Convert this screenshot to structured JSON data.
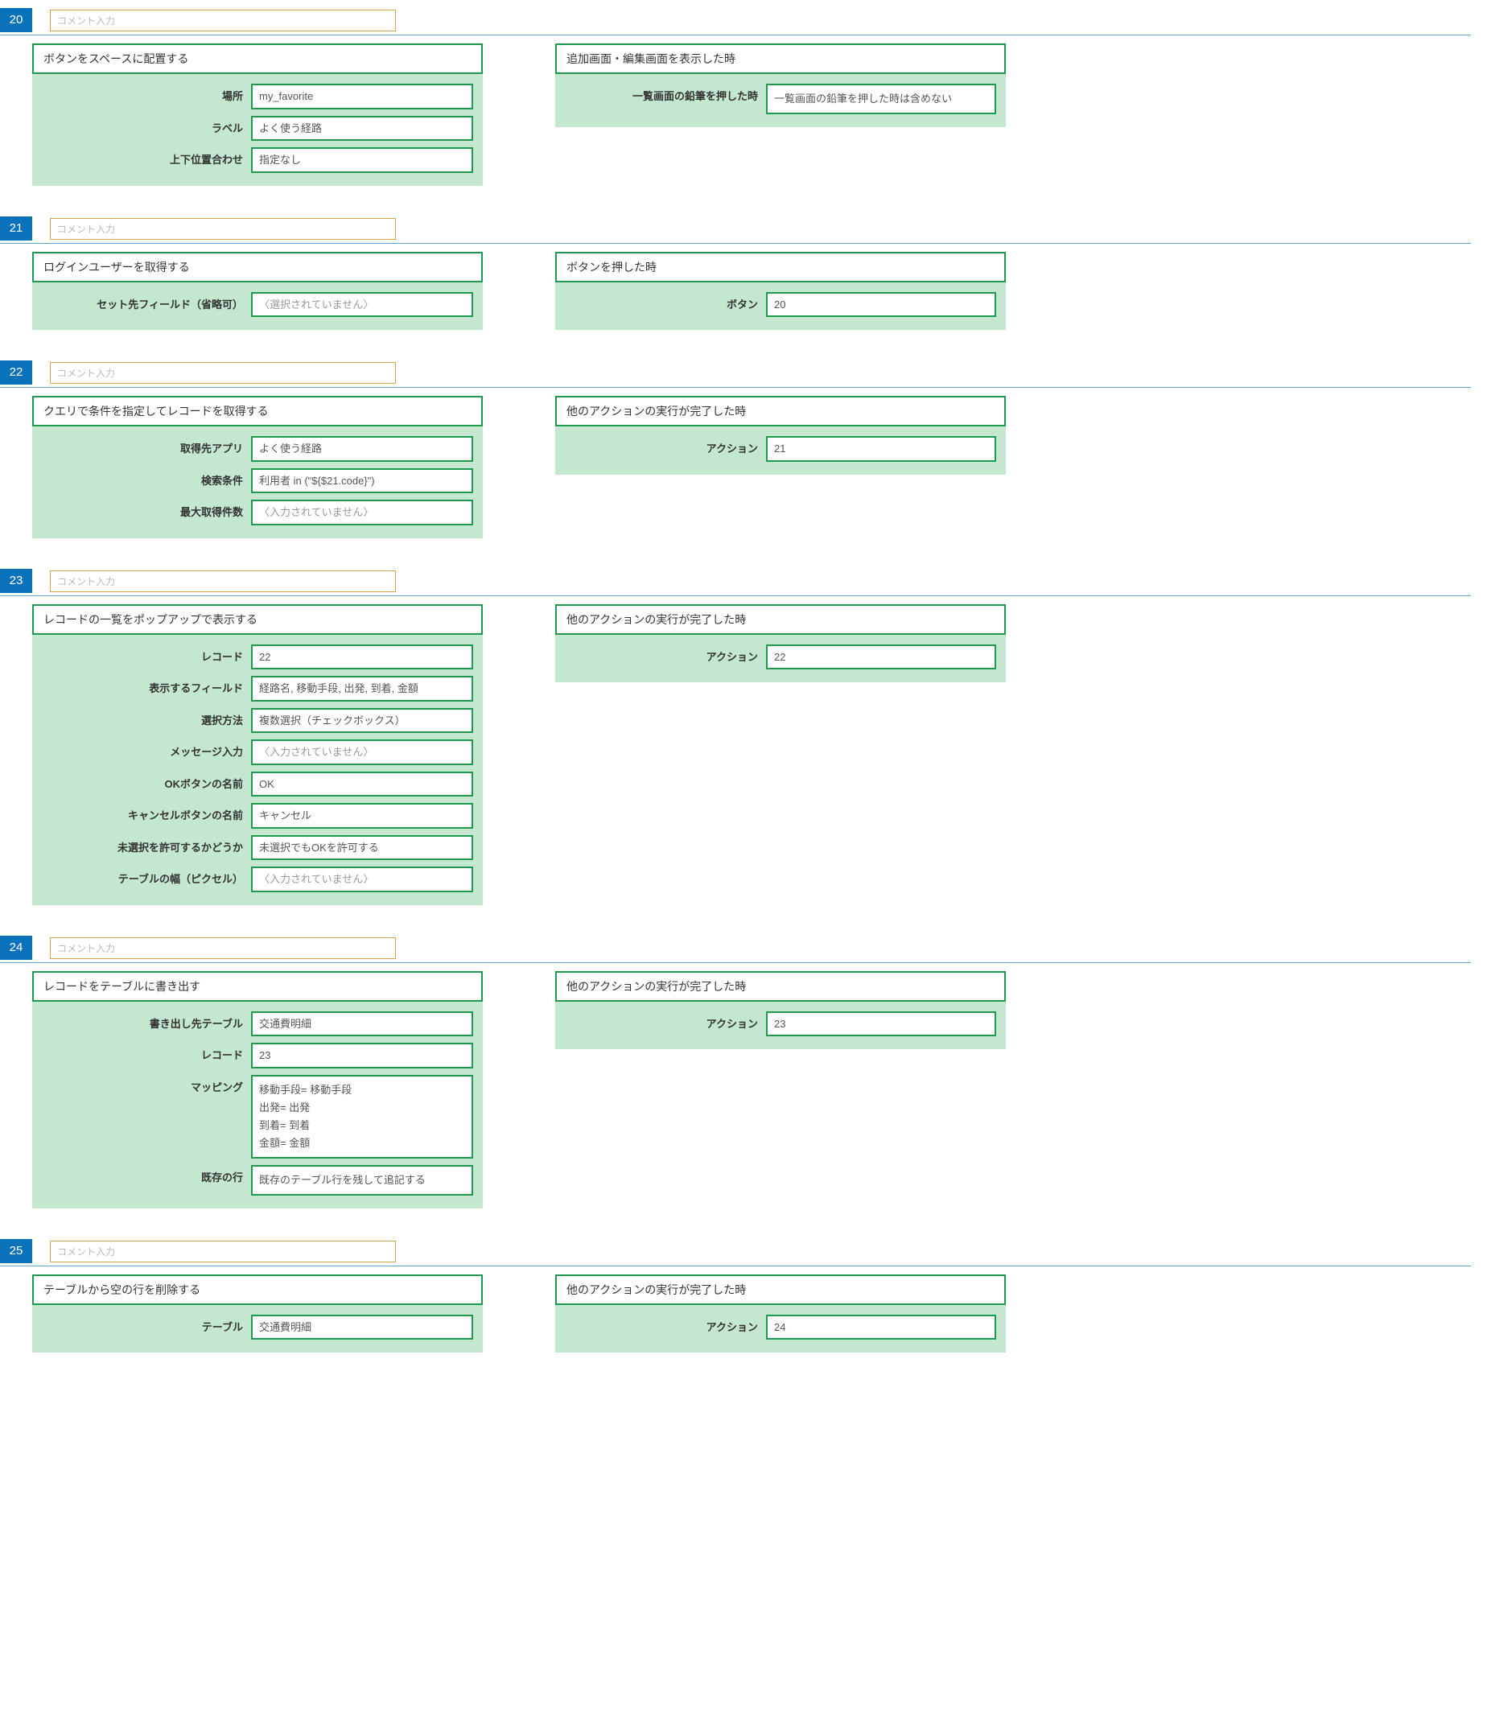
{
  "commentPlaceholder": "コメント入力",
  "blocks": [
    {
      "num": "20",
      "left": {
        "title": "ボタンをスペースに配置する",
        "fields": [
          {
            "label": "場所",
            "value": "my_favorite"
          },
          {
            "label": "ラベル",
            "value": "よく使う経路"
          },
          {
            "label": "上下位置合わせ",
            "value": "指定なし"
          }
        ]
      },
      "right": {
        "title": "追加画面・編集画面を表示した時",
        "fields": [
          {
            "label": "一覧画面の鉛筆を押した時",
            "value": "一覧画面の鉛筆を押した時は含めない",
            "multiline": true
          }
        ]
      }
    },
    {
      "num": "21",
      "left": {
        "title": "ログインユーザーを取得する",
        "fields": [
          {
            "label": "セット先フィールド（省略可）",
            "value": "〈選択されていません〉",
            "placeholder": true
          }
        ]
      },
      "right": {
        "title": "ボタンを押した時",
        "fields": [
          {
            "label": "ボタン",
            "value": "20"
          }
        ]
      }
    },
    {
      "num": "22",
      "left": {
        "title": "クエリで条件を指定してレコードを取得する",
        "fields": [
          {
            "label": "取得先アプリ",
            "value": "よく使う経路"
          },
          {
            "label": "検索条件",
            "value": "利用者 in (\"${$21.code}\")"
          },
          {
            "label": "最大取得件数",
            "value": "〈入力されていません〉",
            "placeholder": true
          }
        ]
      },
      "right": {
        "title": "他のアクションの実行が完了した時",
        "fields": [
          {
            "label": "アクション",
            "value": "21"
          }
        ]
      }
    },
    {
      "num": "23",
      "left": {
        "title": "レコードの一覧をポップアップで表示する",
        "fields": [
          {
            "label": "レコード",
            "value": "22"
          },
          {
            "label": "表示するフィールド",
            "value": "経路名, 移動手段, 出発, 到着, 金額"
          },
          {
            "label": "選択方法",
            "value": "複数選択（チェックボックス）"
          },
          {
            "label": "メッセージ入力",
            "value": "〈入力されていません〉",
            "placeholder": true
          },
          {
            "label": "OKボタンの名前",
            "value": "OK"
          },
          {
            "label": "キャンセルボタンの名前",
            "value": "キャンセル"
          },
          {
            "label": "未選択を許可するかどうか",
            "value": "未選択でもOKを許可する"
          },
          {
            "label": "テーブルの幅（ピクセル）",
            "value": "〈入力されていません〉",
            "placeholder": true
          }
        ]
      },
      "right": {
        "title": "他のアクションの実行が完了した時",
        "fields": [
          {
            "label": "アクション",
            "value": "22"
          }
        ]
      }
    },
    {
      "num": "24",
      "left": {
        "title": "レコードをテーブルに書き出す",
        "fields": [
          {
            "label": "書き出し先テーブル",
            "value": "交通費明細"
          },
          {
            "label": "レコード",
            "value": "23"
          },
          {
            "label": "マッピング",
            "value": "移動手段= 移動手段\n出発= 出発\n到着= 到着\n金額= 金額",
            "multiline": true
          },
          {
            "label": "既存の行",
            "value": "既存のテーブル行を残して追記する",
            "multiline": true
          }
        ]
      },
      "right": {
        "title": "他のアクションの実行が完了した時",
        "fields": [
          {
            "label": "アクション",
            "value": "23"
          }
        ]
      }
    },
    {
      "num": "25",
      "left": {
        "title": "テーブルから空の行を削除する",
        "fields": [
          {
            "label": "テーブル",
            "value": "交通費明細"
          }
        ]
      },
      "right": {
        "title": "他のアクションの実行が完了した時",
        "fields": [
          {
            "label": "アクション",
            "value": "24"
          }
        ]
      }
    }
  ]
}
